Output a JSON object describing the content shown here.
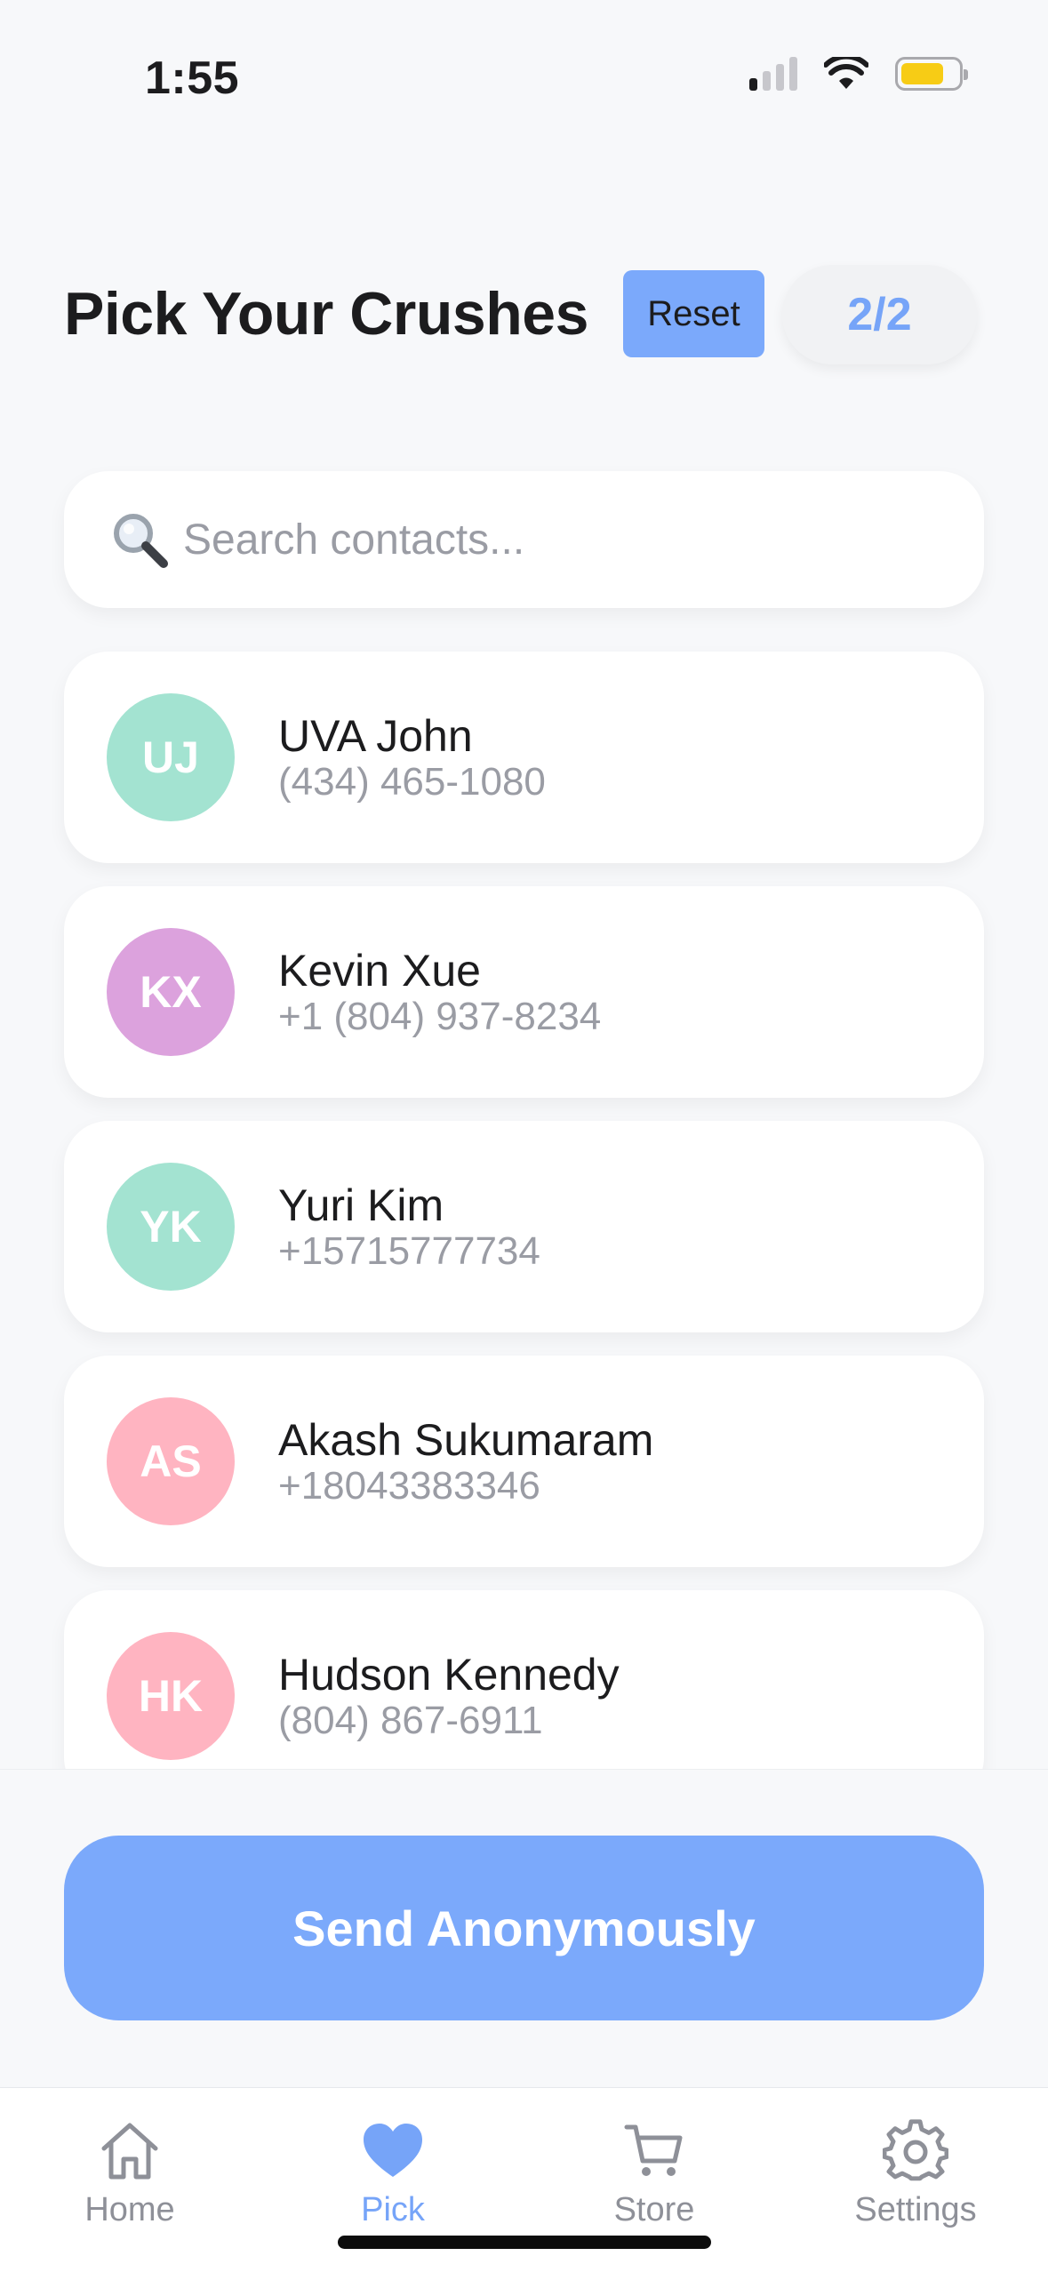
{
  "status_bar": {
    "time": "1:55",
    "signal_bars_on": 1,
    "signal_bars_total": 4,
    "battery_level": 0.75,
    "battery_color": "#f7cc15"
  },
  "header": {
    "title": "Pick Your Crushes",
    "reset_label": "Reset",
    "count": "2/2"
  },
  "search": {
    "placeholder": "Search contacts..."
  },
  "contacts": [
    {
      "initials": "UJ",
      "name": "UVA John",
      "phone": "(434) 465-1080",
      "color": "#a3e3d1"
    },
    {
      "initials": "KX",
      "name": "Kevin Xue",
      "phone": "+1 (804) 937-8234",
      "color": "#dca2dd"
    },
    {
      "initials": "YK",
      "name": "Yuri Kim",
      "phone": "+15715777734",
      "color": "#a3e3d1"
    },
    {
      "initials": "AS",
      "name": "Akash Sukumaram",
      "phone": "+18043383346",
      "color": "#ffb4c1"
    },
    {
      "initials": "HK",
      "name": "Hudson Kennedy",
      "phone": "(804) 867-6911",
      "color": "#ffb4c1"
    }
  ],
  "send_button": {
    "label": "Send Anonymously"
  },
  "tabs": [
    {
      "label": "Home",
      "icon": "home-icon",
      "active": false
    },
    {
      "label": "Pick",
      "icon": "heart-icon",
      "active": true
    },
    {
      "label": "Store",
      "icon": "cart-icon",
      "active": false
    },
    {
      "label": "Settings",
      "icon": "gear-icon",
      "active": false
    }
  ],
  "colors": {
    "accent": "#7ba9fb",
    "accent_text": "#76a4f8",
    "inactive": "#8e9098"
  }
}
